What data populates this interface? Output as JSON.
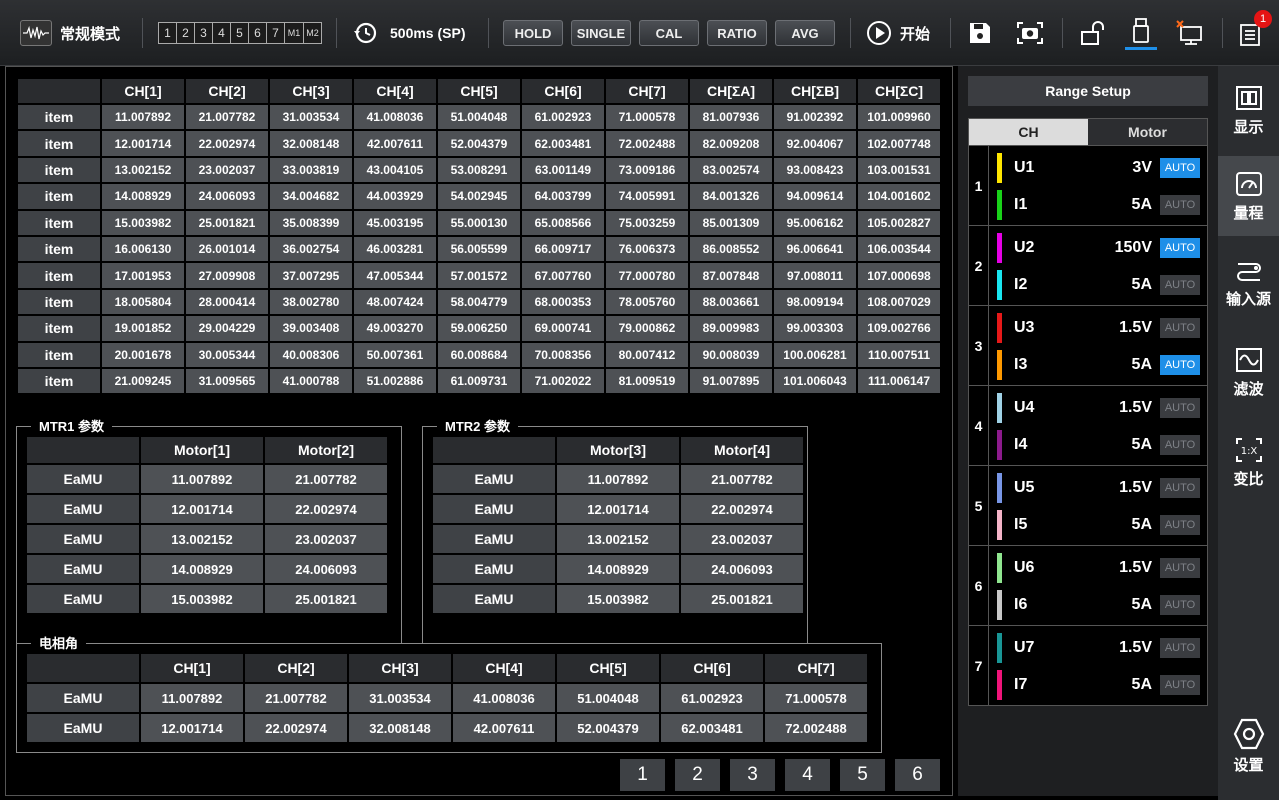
{
  "topbar": {
    "mode_label": "常规模式",
    "pages": [
      "1",
      "2",
      "3",
      "4",
      "5",
      "6",
      "7",
      "M1",
      "M2"
    ],
    "interval_label": "500ms (SP)",
    "buttons": [
      "HOLD",
      "SINGLE",
      "CAL",
      "RATIO",
      "AVG"
    ],
    "start_label": "开始",
    "notification_count": "1"
  },
  "main_table": {
    "headers": [
      "",
      "CH[1]",
      "CH[2]",
      "CH[3]",
      "CH[4]",
      "CH[5]",
      "CH[6]",
      "CH[7]",
      "CH[ΣA]",
      "CH[ΣB]",
      "CH[ΣC]"
    ],
    "rows": [
      [
        "item",
        "11.007892",
        "21.007782",
        "31.003534",
        "41.008036",
        "51.004048",
        "61.002923",
        "71.000578",
        "81.007936",
        "91.002392",
        "101.009960"
      ],
      [
        "item",
        "12.001714",
        "22.002974",
        "32.008148",
        "42.007611",
        "52.004379",
        "62.003481",
        "72.002488",
        "82.009208",
        "92.004067",
        "102.007748"
      ],
      [
        "item",
        "13.002152",
        "23.002037",
        "33.003819",
        "43.004105",
        "53.008291",
        "63.001149",
        "73.009186",
        "83.002574",
        "93.008423",
        "103.001531"
      ],
      [
        "item",
        "14.008929",
        "24.006093",
        "34.004682",
        "44.003929",
        "54.002945",
        "64.003799",
        "74.005991",
        "84.001326",
        "94.009614",
        "104.001602"
      ],
      [
        "item",
        "15.003982",
        "25.001821",
        "35.008399",
        "45.003195",
        "55.000130",
        "65.008566",
        "75.003259",
        "85.001309",
        "95.006162",
        "105.002827"
      ],
      [
        "item",
        "16.006130",
        "26.001014",
        "36.002754",
        "46.003281",
        "56.005599",
        "66.009717",
        "76.006373",
        "86.008552",
        "96.006641",
        "106.003544"
      ],
      [
        "item",
        "17.001953",
        "27.009908",
        "37.007295",
        "47.005344",
        "57.001572",
        "67.007760",
        "77.000780",
        "87.007848",
        "97.008011",
        "107.000698"
      ],
      [
        "item",
        "18.005804",
        "28.000414",
        "38.002780",
        "48.007424",
        "58.004779",
        "68.000353",
        "78.005760",
        "88.003661",
        "98.009194",
        "108.007029"
      ],
      [
        "item",
        "19.001852",
        "29.004229",
        "39.003408",
        "49.003270",
        "59.006250",
        "69.000741",
        "79.000862",
        "89.009983",
        "99.003303",
        "109.002766"
      ],
      [
        "item",
        "20.001678",
        "30.005344",
        "40.008306",
        "50.007361",
        "60.008684",
        "70.008356",
        "80.007412",
        "90.008039",
        "100.006281",
        "110.007511"
      ],
      [
        "item",
        "21.009245",
        "31.009565",
        "41.000788",
        "51.002886",
        "61.009731",
        "71.002022",
        "81.009519",
        "91.007895",
        "101.006043",
        "111.006147"
      ]
    ]
  },
  "mtr1": {
    "label": "MTR1 参数",
    "headers": [
      "",
      "Motor[1]",
      "Motor[2]"
    ],
    "rows": [
      [
        "EaMU",
        "11.007892",
        "21.007782"
      ],
      [
        "EaMU",
        "12.001714",
        "22.002974"
      ],
      [
        "EaMU",
        "13.002152",
        "23.002037"
      ],
      [
        "EaMU",
        "14.008929",
        "24.006093"
      ],
      [
        "EaMU",
        "15.003982",
        "25.001821"
      ]
    ]
  },
  "mtr2": {
    "label": "MTR2 参数",
    "headers": [
      "",
      "Motor[3]",
      "Motor[4]"
    ],
    "rows": [
      [
        "EaMU",
        "11.007892",
        "21.007782"
      ],
      [
        "EaMU",
        "12.001714",
        "22.002974"
      ],
      [
        "EaMU",
        "13.002152",
        "23.002037"
      ],
      [
        "EaMU",
        "14.008929",
        "24.006093"
      ],
      [
        "EaMU",
        "15.003982",
        "25.001821"
      ]
    ]
  },
  "phase": {
    "label": "电相角",
    "headers": [
      "",
      "CH[1]",
      "CH[2]",
      "CH[3]",
      "CH[4]",
      "CH[5]",
      "CH[6]",
      "CH[7]"
    ],
    "rows": [
      [
        "EaMU",
        "11.007892",
        "21.007782",
        "31.003534",
        "41.008036",
        "51.004048",
        "61.002923",
        "71.000578"
      ],
      [
        "EaMU",
        "12.001714",
        "22.002974",
        "32.008148",
        "42.007611",
        "52.004379",
        "62.003481",
        "72.002488"
      ]
    ]
  },
  "pager": [
    "1",
    "2",
    "3",
    "4",
    "5",
    "6"
  ],
  "range_setup": {
    "title": "Range Setup",
    "tabs": [
      "CH",
      "Motor"
    ],
    "channels": [
      {
        "num": "1",
        "u": {
          "name": "U1",
          "value": "3V",
          "auto": true,
          "color": "#ffe600"
        },
        "i": {
          "name": "I1",
          "value": "5A",
          "auto": false,
          "color": "#19d219"
        }
      },
      {
        "num": "2",
        "u": {
          "name": "U2",
          "value": "150V",
          "auto": true,
          "color": "#e600e6"
        },
        "i": {
          "name": "I2",
          "value": "5A",
          "auto": false,
          "color": "#19e6f0"
        }
      },
      {
        "num": "3",
        "u": {
          "name": "U3",
          "value": "1.5V",
          "auto": false,
          "color": "#e61919"
        },
        "i": {
          "name": "I3",
          "value": "5A",
          "auto": true,
          "color": "#ff9900"
        }
      },
      {
        "num": "4",
        "u": {
          "name": "U4",
          "value": "1.5V",
          "auto": false,
          "color": "#a0d2e6"
        },
        "i": {
          "name": "I4",
          "value": "5A",
          "auto": false,
          "color": "#8c1a8c"
        }
      },
      {
        "num": "5",
        "u": {
          "name": "U5",
          "value": "1.5V",
          "auto": false,
          "color": "#7896e6"
        },
        "i": {
          "name": "I5",
          "value": "5A",
          "auto": false,
          "color": "#f5b4c8"
        }
      },
      {
        "num": "6",
        "u": {
          "name": "U6",
          "value": "1.5V",
          "auto": false,
          "color": "#90e690"
        },
        "i": {
          "name": "I6",
          "value": "5A",
          "auto": false,
          "color": "#c8c8c8"
        }
      },
      {
        "num": "7",
        "u": {
          "name": "U7",
          "value": "1.5V",
          "auto": false,
          "color": "#199696"
        },
        "i": {
          "name": "I7",
          "value": "5A",
          "auto": false,
          "color": "#f0147a"
        }
      }
    ],
    "auto_label": "AUTO"
  },
  "nav": [
    "显示",
    "量程",
    "输入源",
    "滤波",
    "变比",
    "设置"
  ]
}
